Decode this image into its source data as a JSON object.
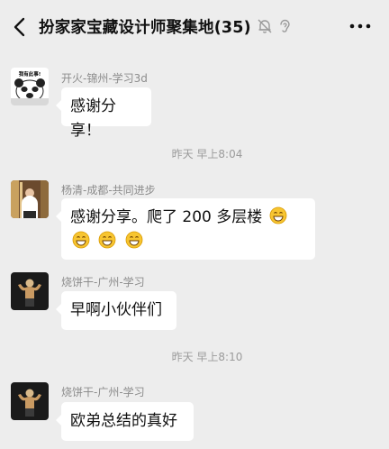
{
  "header": {
    "title": "扮家家宝藏设计师聚集地(35)"
  },
  "messages": [
    {
      "sender": "开火-锦州-学习3d",
      "text": "感谢分享！"
    },
    {
      "sender": "杨清-成都-共同进步",
      "text": "感谢分享。爬了 200 多层楼"
    },
    {
      "sender": "烧饼干-广州-学习",
      "text": "早啊小伙伴们"
    },
    {
      "sender": "烧饼干-广州-学习",
      "text": "欧弟总结的真好"
    }
  ],
  "timestamps": [
    "昨天 早上8:04",
    "昨天 早上8:10"
  ],
  "avatar1_caption": "我有此事!",
  "icons": {
    "back": "chevron-left-icon",
    "mute": "bell-off-icon",
    "ear": "ear-icon",
    "more": "more-dots-icon",
    "emoji": "grin-emoji-icon"
  },
  "colors": {
    "background": "#ededed",
    "bubble": "#ffffff",
    "meta_text": "#9b9b9b"
  }
}
